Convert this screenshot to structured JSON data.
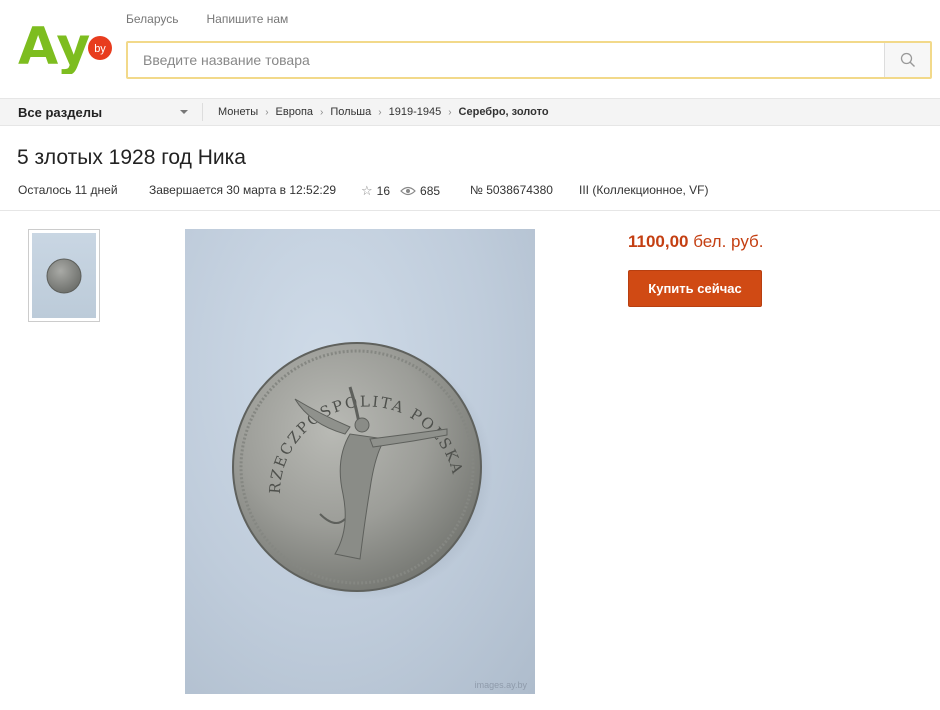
{
  "header": {
    "logo_text": "Ay",
    "logo_badge": "by",
    "top_links": [
      "Беларусь",
      "Напишите нам"
    ],
    "search_placeholder": "Введите название товара"
  },
  "nav": {
    "all_sections": "Все разделы",
    "breadcrumb": [
      "Монеты",
      "Европа",
      "Польша",
      "1919-1945",
      "Серебро, золото"
    ]
  },
  "lot": {
    "title": "5 злотых 1928 год Ника",
    "remaining": "Осталось  11 дней",
    "ends": "Завершается 30 марта в 12:52:29",
    "favorites": "16",
    "views": "685",
    "number": "№ 5038674380",
    "condition": "III (Коллекционное, VF)",
    "price_amount": "1100,00",
    "price_currency": "бел. руб.",
    "buy_label": "Купить сейчас",
    "photo_watermark": "images.ay.by",
    "coin_inscription": "RZECZPOSPOLITA POLSKA"
  },
  "colors": {
    "brand_green": "#7dbd1f",
    "badge_red": "#e83c1e",
    "price": "#c43f12",
    "buy_button": "#d04a14",
    "search_border": "#f2d98a"
  },
  "icons": [
    "search-icon",
    "chevron-down-icon",
    "star-icon",
    "eye-icon"
  ]
}
